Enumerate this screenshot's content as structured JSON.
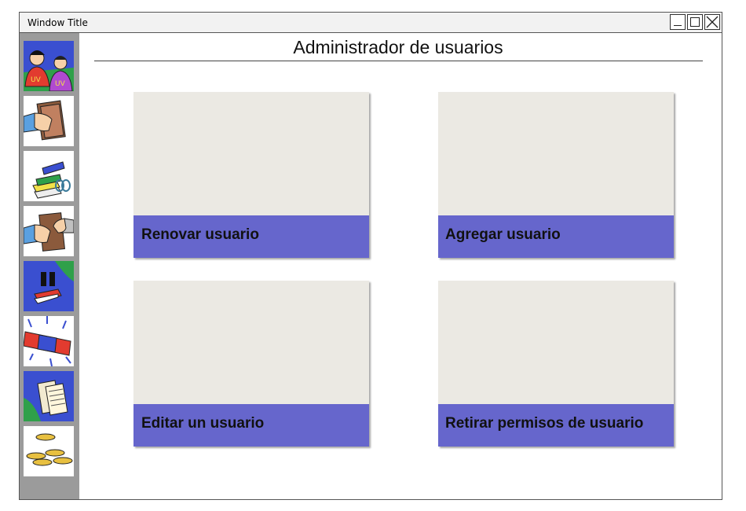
{
  "window": {
    "title": "Window Title"
  },
  "page": {
    "title": "Administrador de usuarios"
  },
  "sidebar": {
    "icons": [
      "users-icon",
      "book-handover-icon",
      "books-stack-icon",
      "book-return-icon",
      "pause-book-icon",
      "alert-siren-icon",
      "documents-icon",
      "coins-icon"
    ]
  },
  "cards": [
    {
      "label": "Renovar usuario"
    },
    {
      "label": "Agregar usuario"
    },
    {
      "label": "Editar un usuario"
    },
    {
      "label": "Retirar permisos de usuario"
    }
  ],
  "colors": {
    "card_band": "#6666cc",
    "card_body": "#ebe9e3",
    "sidebar": "#9b9b9b"
  }
}
